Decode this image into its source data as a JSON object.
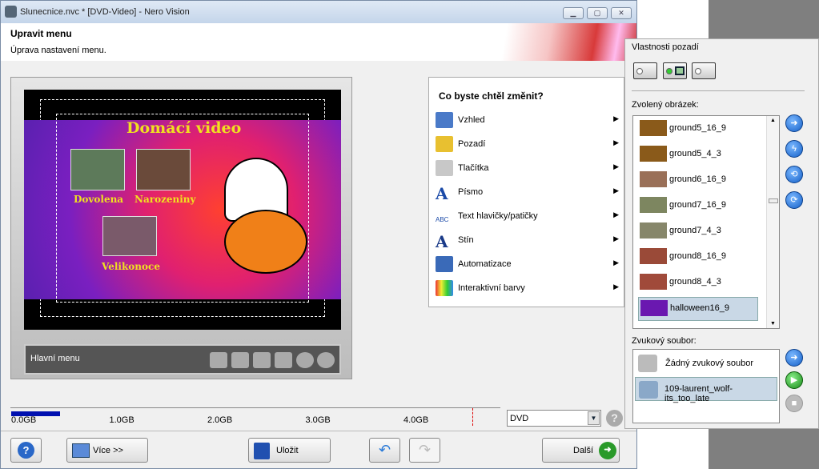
{
  "window": {
    "title": "Slunecnice.nvc * [DVD-Video] - Nero Vision"
  },
  "header": {
    "title": "Upravit menu",
    "subtitle": "Úprava nastavení menu."
  },
  "preview": {
    "menu_title": "Domácí video",
    "items": [
      "Dovolena",
      "Narozeniny",
      "Velikonoce"
    ],
    "bar_label": "Hlavní menu"
  },
  "change_menu": {
    "heading": "Co byste chtěl změnit?",
    "items": [
      "Vzhled",
      "Pozadí",
      "Tlačítka",
      "Písmo",
      "Text hlavičky/patičky",
      "Stín",
      "Automatizace",
      "Interaktivní barvy"
    ]
  },
  "background_props": {
    "group_label": "Vlastnosti pozadí",
    "selected_image_label": "Zvolený obrázek:",
    "images": [
      "ground5_16_9",
      "ground5_4_3",
      "ground6_16_9",
      "ground7_16_9",
      "ground7_4_3",
      "ground8_16_9",
      "ground8_4_3",
      "halloween16_9"
    ],
    "selected_image": "halloween16_9",
    "swatch_colors": [
      "#8a5a1a",
      "#8a5a1a",
      "#9a7058",
      "#7d8660",
      "#86866a",
      "#9a4a38",
      "#a04a3a",
      "#6a18b0"
    ],
    "sound_label": "Zvukový soubor:",
    "sounds": [
      "Žádný zvukový soubor",
      "109-laurent_wolf-its_too_late"
    ],
    "selected_sound": "109-laurent_wolf-its_too_late"
  },
  "capacity": {
    "ticks": [
      "0.0GB",
      "1.0GB",
      "2.0GB",
      "3.0GB",
      "4.0GB"
    ],
    "used_gb": 0.5,
    "max_gb": 4.7,
    "disc_type": "DVD"
  },
  "buttons": {
    "more": "Více >>",
    "save": "Uložit",
    "next": "Další"
  }
}
